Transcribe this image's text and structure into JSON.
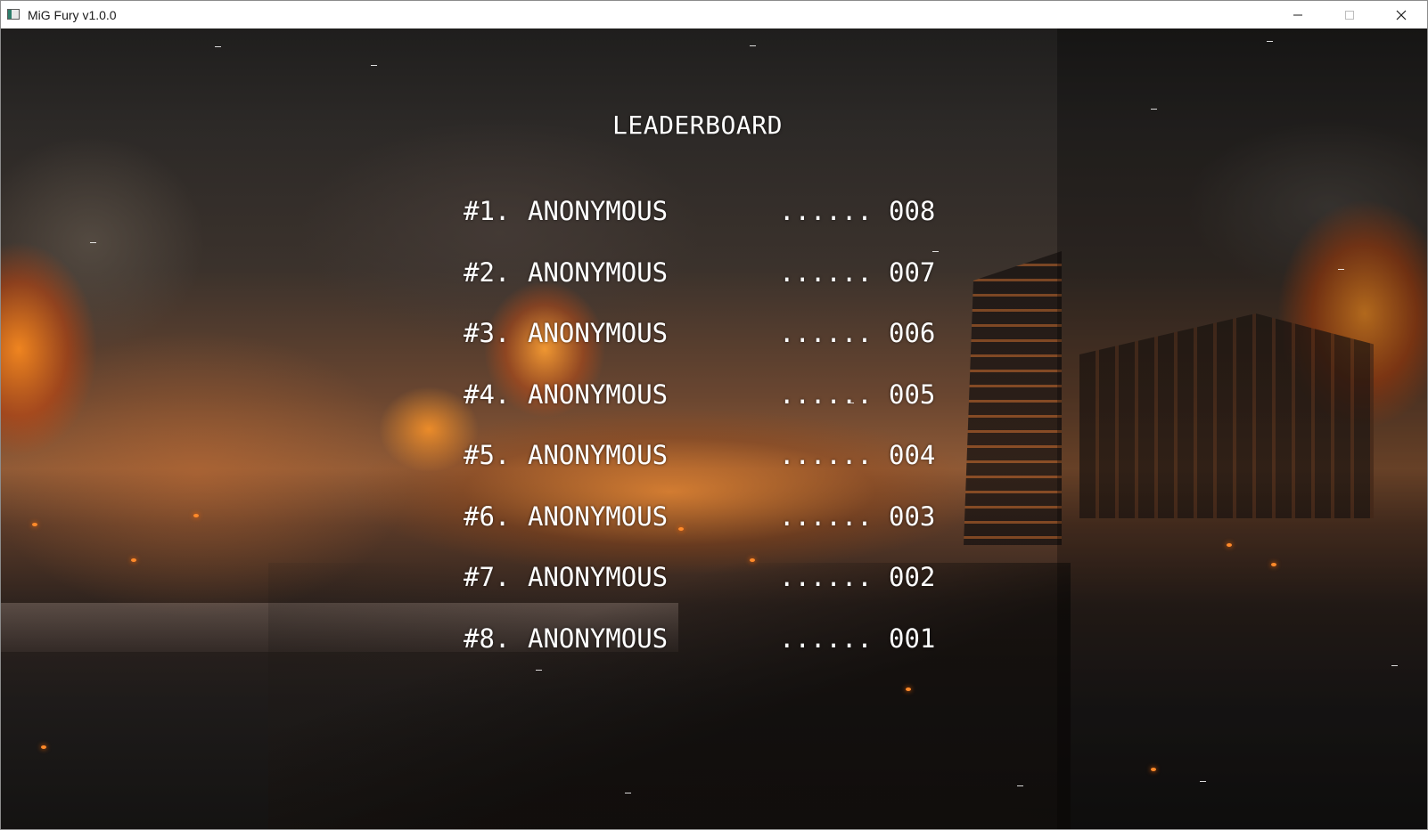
{
  "window": {
    "title": "MiG Fury v1.0.0",
    "controls": [
      "minimize",
      "maximize",
      "close"
    ]
  },
  "leaderboard": {
    "title": "LEADERBOARD",
    "entries": [
      {
        "rank": "#1.",
        "name": "ANONYMOUS",
        "dots": "......",
        "score": "008"
      },
      {
        "rank": "#2.",
        "name": "ANONYMOUS",
        "dots": "......",
        "score": "007"
      },
      {
        "rank": "#3.",
        "name": "ANONYMOUS",
        "dots": "......",
        "score": "006"
      },
      {
        "rank": "#4.",
        "name": "ANONYMOUS",
        "dots": "......",
        "score": "005"
      },
      {
        "rank": "#5.",
        "name": "ANONYMOUS",
        "dots": "......",
        "score": "004"
      },
      {
        "rank": "#6.",
        "name": "ANONYMOUS",
        "dots": "......",
        "score": "003"
      },
      {
        "rank": "#7.",
        "name": "ANONYMOUS",
        "dots": "......",
        "score": "002"
      },
      {
        "rank": "#8.",
        "name": "ANONYMOUS",
        "dots": "......",
        "score": "001"
      }
    ]
  },
  "colors": {
    "text": "#ffffff",
    "fire": "#ff8a2a"
  }
}
